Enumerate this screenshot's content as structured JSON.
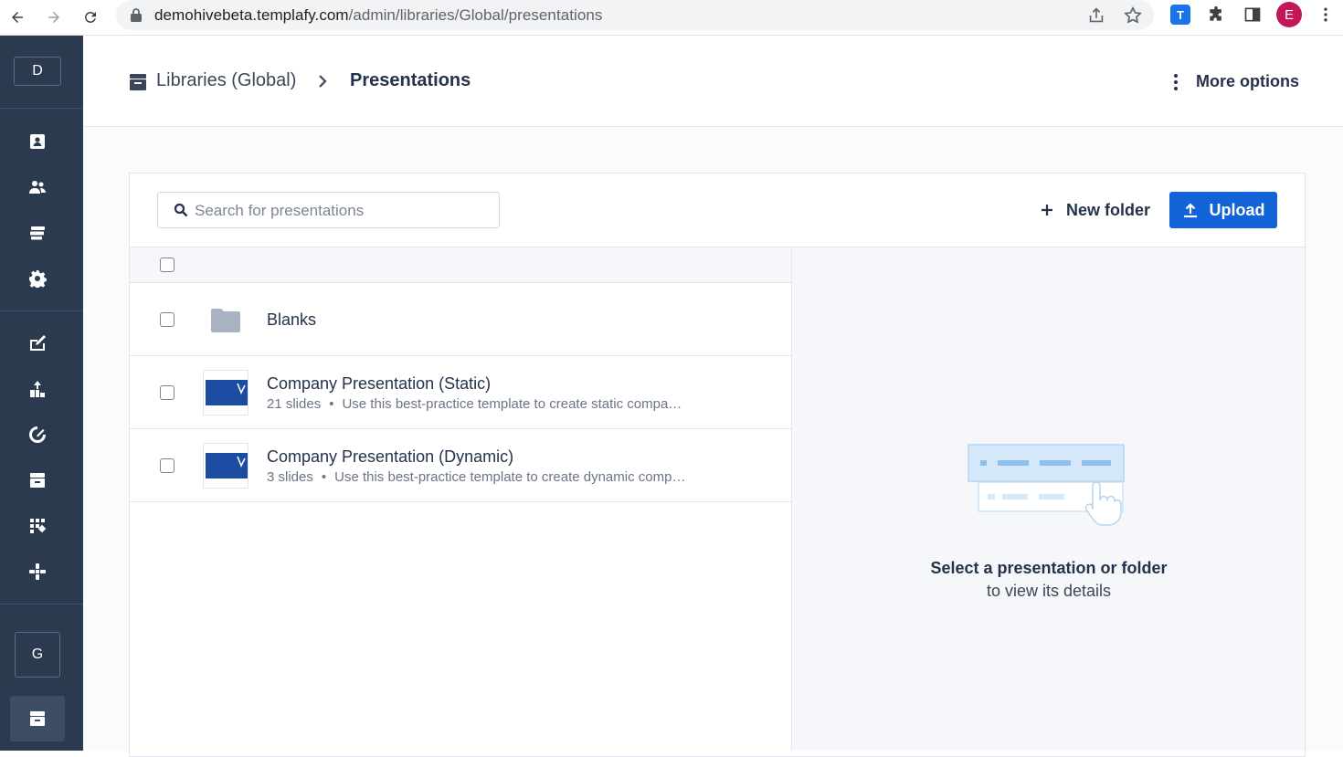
{
  "browser": {
    "url_host": "demohivebeta.templafy.com",
    "url_path": "/admin/libraries/Global/presentations",
    "extension_label": "T",
    "profile_initial": "E"
  },
  "sidebar": {
    "top_avatar": "D",
    "bottom_avatar": "G",
    "icons": [
      "contact-card-icon",
      "users-icon",
      "library-stack-icon",
      "gear-icon",
      "edit-document-icon",
      "hierarchy-icon",
      "analytics-icon",
      "archive-icon",
      "apps-grid-icon",
      "integrations-icon",
      "library-archive-icon"
    ]
  },
  "header": {
    "breadcrumb_root": "Libraries (Global)",
    "breadcrumb_current": "Presentations",
    "more_options": "More options"
  },
  "toolbar": {
    "search_placeholder": "Search for presentations",
    "new_folder_label": "New folder",
    "upload_label": "Upload"
  },
  "items": [
    {
      "type": "folder",
      "title": "Blanks"
    },
    {
      "type": "presentation",
      "title": "Company Presentation (Static)",
      "slides": "21 slides",
      "description": "Use this best-practice template to create static compa…"
    },
    {
      "type": "presentation",
      "title": "Company Presentation (Dynamic)",
      "slides": "3 slides",
      "description": "Use this best-practice template to create dynamic comp…"
    }
  ],
  "details": {
    "empty_line1": "Select a presentation or folder",
    "empty_line2": "to view its details"
  },
  "colors": {
    "sidebar_bg": "#2b3a4f",
    "primary_blue": "#1262d8",
    "details_bg": "#f5f7fa"
  }
}
